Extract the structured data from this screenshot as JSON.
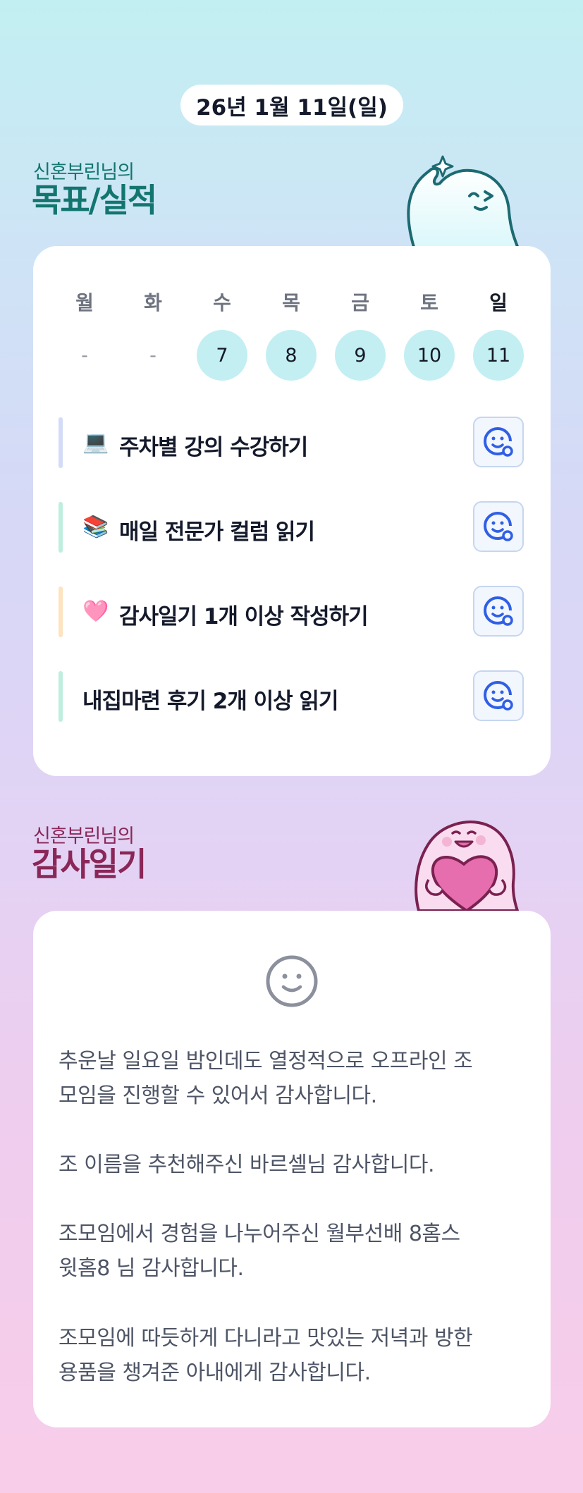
{
  "header": {
    "date": "26년 1월 11일(일)"
  },
  "goals_section": {
    "subtitle": "신혼부린님의",
    "title": "목표/실적"
  },
  "week": {
    "days": [
      {
        "name": "월",
        "value": "-"
      },
      {
        "name": "화",
        "value": "-"
      },
      {
        "name": "수",
        "value": "7"
      },
      {
        "name": "목",
        "value": "8"
      },
      {
        "name": "금",
        "value": "9"
      },
      {
        "name": "토",
        "value": "10"
      },
      {
        "name": "일",
        "value": "11"
      }
    ]
  },
  "goals": [
    {
      "emoji": "💻",
      "label": "주차별 강의 수강하기",
      "bar_color": "#d3dcf7",
      "icon": "smiley-add-icon"
    },
    {
      "emoji": "📚",
      "label": "매일 전문가 컬럼 읽기",
      "bar_color": "#bfeedd",
      "icon": "smiley-add-icon"
    },
    {
      "emoji": "🩷",
      "label": "감사일기 1개 이상 작성하기",
      "bar_color": "#fde3bf",
      "icon": "smiley-add-icon"
    },
    {
      "emoji": "",
      "label": "내집마련 후기 2개 이상 읽기",
      "bar_color": "#bfeedd",
      "icon": "smiley-add-icon"
    }
  ],
  "gratitude_section": {
    "subtitle": "신혼부린님의",
    "title": "감사일기"
  },
  "gratitude": {
    "mood_icon": "smiley-face-icon",
    "entries": [
      [
        "추운날 일요일 밤인데도 열정적으로 오프라인 조",
        "모임을 진행할 수 있어서 감사합니다."
      ],
      [
        "조 이름을 추천해주신 바르셀님 감사합니다."
      ],
      [
        "조모임에서 경험을 나누어주신 월부선배 8홈스",
        "윗홈8 님 감사합니다."
      ],
      [
        "조모임에 따듯하게 다니라고 맛있는 저녁과 방한",
        "용품을 챙겨준 아내에게 감사합니다."
      ]
    ]
  },
  "colors": {
    "accent_blue": "#2f5fe6",
    "teal_title": "#13756f",
    "plum_title": "#8a2758",
    "day_circle": "#c3eff3"
  }
}
